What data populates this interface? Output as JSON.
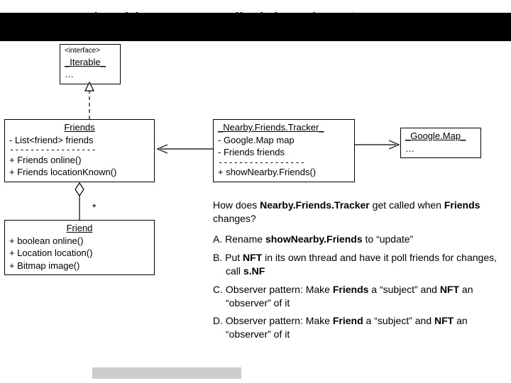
{
  "title": "How should NFT get called, by whom?",
  "boxes": {
    "iterable": {
      "stereotype": "<interface>",
      "name": "_Iterable_",
      "body": "…"
    },
    "friends": {
      "name": "Friends",
      "body1": "- List<friend> friends",
      "divider": "-----------------",
      "body2a": "+ Friends online()",
      "body2b": "+ Friends locationKnown()"
    },
    "friend": {
      "name": "Friend",
      "body1": "+ boolean online()",
      "body2": "+ Location location()",
      "body3": "+ Bitmap image()"
    },
    "nft": {
      "name": "_Nearby.Friends.Tracker_",
      "line1": "- Google.Map map",
      "line2": "- Friends friends",
      "divider": "-----------------",
      "line3": "+ showNearby.Friends()"
    },
    "gmap": {
      "name": "_Google.Map_",
      "body": "…"
    }
  },
  "multiplicity": "*",
  "question": {
    "prefix": "How does ",
    "subject": "Nearby.Friends.Tracker",
    "mid": " get called when ",
    "subject2": "Friends",
    "suffix": " changes?"
  },
  "options": {
    "a": {
      "label": "A.",
      "pre": "Rename ",
      "b1": "showNearby.Friends",
      "post": " to “update”"
    },
    "b": {
      "label": "B.",
      "pre": "Put ",
      "b1": "NFT",
      "mid": " in its own thread and have it poll friends for changes, call ",
      "b2": "s.NF"
    },
    "c": {
      "label": "C.",
      "pre": "Observer pattern: Make ",
      "b1": "Friends",
      "mid": " a “subject” and ",
      "b2": "NFT",
      "post": " an “observer” of it"
    },
    "d": {
      "label": "D.",
      "pre": "Observer pattern: Make ",
      "b1": "Friend",
      "mid": " a “subject” and ",
      "b2": "NFT",
      "post": " an “observer” of it"
    }
  }
}
